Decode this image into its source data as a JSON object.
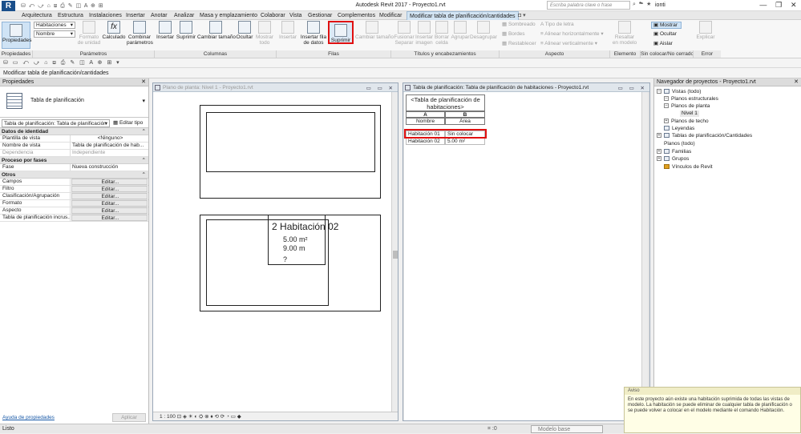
{
  "app": {
    "logo": "R",
    "title": "Autodesk Revit 2017 -",
    "file": "Proyecto1.rvt",
    "qat": "⛁ ⤺ ⤻ ⌂ ⧈ ⎙ ✎ ◫ A ⊕ ⊞",
    "search_placeholder": "Escriba palabra clave o frase",
    "title_icons": "⌕ ☁ ★",
    "user": "ionti",
    "win_controls": [
      "—",
      "❐",
      "✕"
    ]
  },
  "tabs": [
    "Arquitectura",
    "Estructura",
    "Instalaciones",
    "Insertar",
    "Anotar",
    "Analizar",
    "Masa y emplazamiento",
    "Colaborar",
    "Vista",
    "Gestionar",
    "Complementos",
    "Modificar",
    "Modificar tabla de planificación/cantidades"
  ],
  "tab_extra": "◘ ▾",
  "ribbon": {
    "props_btn": "Propiedades",
    "combo1": "Habitaciones",
    "combo2": "Nombre",
    "param_btns": [
      "Formato de unidad",
      "Calculado",
      "Combinar parámetros"
    ],
    "col_btns": [
      "Insertar",
      "Suprimir",
      "Cambiar tamaño",
      "Ocultar",
      "Mostrar todo"
    ],
    "row_btns": [
      "Insertar",
      "Insertar fila de datos",
      "Suprimir",
      "Cambiar tamaño"
    ],
    "title_btns": [
      "Fusionar Separar",
      "Insertar imagen",
      "Borrar celda",
      "Agrupar",
      "Desagrupar"
    ],
    "aspect_left": [
      "Sombreado",
      "Bordes",
      "Restablecer"
    ],
    "aspect_right": [
      "Tipo de letra",
      "Alinear horizontalmente",
      "Alinear verticalmente"
    ],
    "elem_btn": "Resaltar en modelo",
    "show_btns": [
      "Mostrar",
      "Ocultar",
      "Aislar"
    ],
    "error_btn": "Explicar",
    "groups": [
      "Propiedades",
      "Parámetros",
      "Columnas",
      "Filas",
      "Títulos y encabezamientos",
      "Aspecto",
      "Elemento",
      "Sin colocar/No cerrado",
      "Error"
    ]
  },
  "toolbar2": "⛁ ▭ ⤺ ⤻ ⌂ ⧈ ⎙ ✎ ◫ A ⊕ ⊞ ▾",
  "context_title": "Modificar tabla de planificación/cantidades",
  "properties": {
    "header": "Propiedades",
    "close": "✕",
    "type_label": "Tabla de planificación",
    "filter": "Tabla de planificación: Tabla de planificación",
    "edit_type": "Editar tipo",
    "groups": [
      {
        "name": "Datos de identidad",
        "rows": [
          [
            "Plantilla de vista",
            "<Ninguno>"
          ],
          [
            "Nombre de vista",
            "Tabla de planificación de hab..."
          ],
          [
            "Dependencia",
            "Independiente"
          ]
        ]
      },
      {
        "name": "Proceso por fases",
        "rows": [
          [
            "Fase",
            "Nueva construcción"
          ]
        ]
      },
      {
        "name": "Otros",
        "rows": [
          [
            "Campos",
            "Editar..."
          ],
          [
            "Filtro",
            "Editar..."
          ],
          [
            "Clasificación/Agrupación",
            "Editar..."
          ],
          [
            "Formato",
            "Editar..."
          ],
          [
            "Aspecto",
            "Editar..."
          ],
          [
            "Tabla de planificación incrus...",
            "Editar..."
          ]
        ]
      }
    ],
    "help": "Ayuda de propiedades",
    "apply": "Aplicar"
  },
  "plan_view": {
    "title": "Plano de planta: Nivel 1 - Proyecto1.rvt",
    "win_controls": "▭ ▭ ✕",
    "tag_number": "2",
    "tag_name": "Habitación 02",
    "tag_area": "5.00 m²",
    "tag_perimeter": "9.00 m",
    "tag_unknown": "?",
    "scale": "1 : 100",
    "controls": "⊡ ◈ ☀ ◐ ⛭ ⊗ ♦ ⟲ ⟳ ◔ ▭ ◆"
  },
  "schedule_view": {
    "title": "Tabla de planificación: Tabla de planificación de habitaciones - Proyecto1.rvt",
    "win_controls": "▭ ▭ ✕",
    "heading": "<Tabla de planificación de habitaciones>",
    "col_letters": [
      "A",
      "B"
    ],
    "col_names": [
      "Nombre",
      "Área"
    ],
    "rows": [
      [
        "Habitación 01",
        "Sin colocar"
      ],
      [
        "Habitación 02",
        "5.00 m²"
      ]
    ]
  },
  "browser": {
    "header": "Navegador de proyectos - Proyecto1.rvt",
    "close": "✕",
    "items": [
      "Vistas (todo)",
      "Planos estructurales",
      "Planos de planta",
      "Nivel 1",
      "Planos de techo",
      "Leyendas",
      "Tablas de planificación/Cantidades",
      "Planos (todo)",
      "Familias",
      "Grupos",
      "Vínculos de Revit"
    ]
  },
  "status": {
    "text": "Listo",
    "zoom_value": ":0",
    "model": "Modelo base"
  },
  "warning": {
    "header": "Aviso",
    "body": "En este proyecto aún existe una habitación suprimida de todas las vistas de modelo. La habitación se puede eliminar de cualquier tabla de planificación o se puede volver a colocar en el modelo mediante el comando Habitación."
  }
}
